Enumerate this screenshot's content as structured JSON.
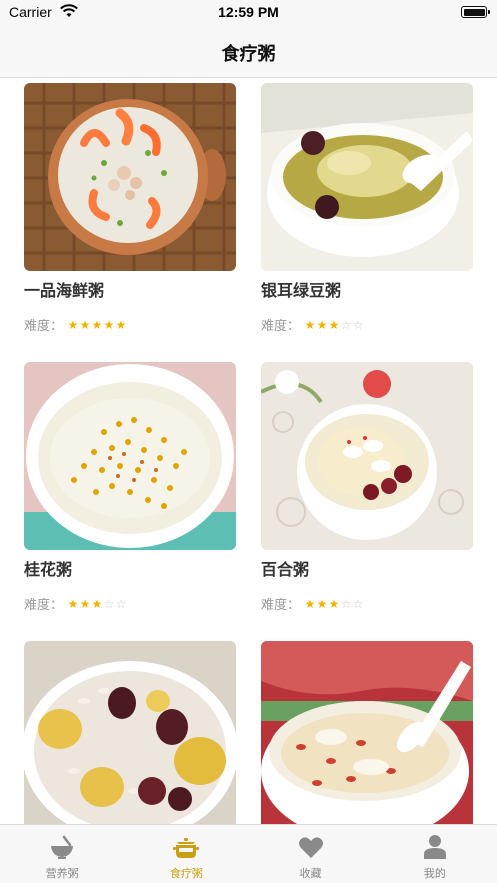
{
  "status_bar": {
    "carrier": "Carrier",
    "time": "12:59 PM"
  },
  "nav": {
    "title": "食疗粥"
  },
  "rating_label": "难度：",
  "colors": {
    "accent": "#c9a013",
    "star": "#f0b400",
    "tab_inactive": "#888888"
  },
  "recipes": [
    {
      "title": "一品海鲜粥",
      "difficulty": 5,
      "max": 5
    },
    {
      "title": "银耳绿豆粥",
      "difficulty": 3,
      "max": 5
    },
    {
      "title": "桂花粥",
      "difficulty": 3,
      "max": 5
    },
    {
      "title": "百合粥",
      "difficulty": 3,
      "max": 5
    },
    {
      "title": "",
      "difficulty": 0,
      "max": 5
    },
    {
      "title": "",
      "difficulty": 0,
      "max": 5
    }
  ],
  "tabs": [
    {
      "label": "营养粥",
      "icon": "bowl-icon",
      "active": false
    },
    {
      "label": "食疗粥",
      "icon": "pot-icon",
      "active": true
    },
    {
      "label": "收藏",
      "icon": "heart-icon",
      "active": false
    },
    {
      "label": "我的",
      "icon": "person-icon",
      "active": false
    }
  ]
}
